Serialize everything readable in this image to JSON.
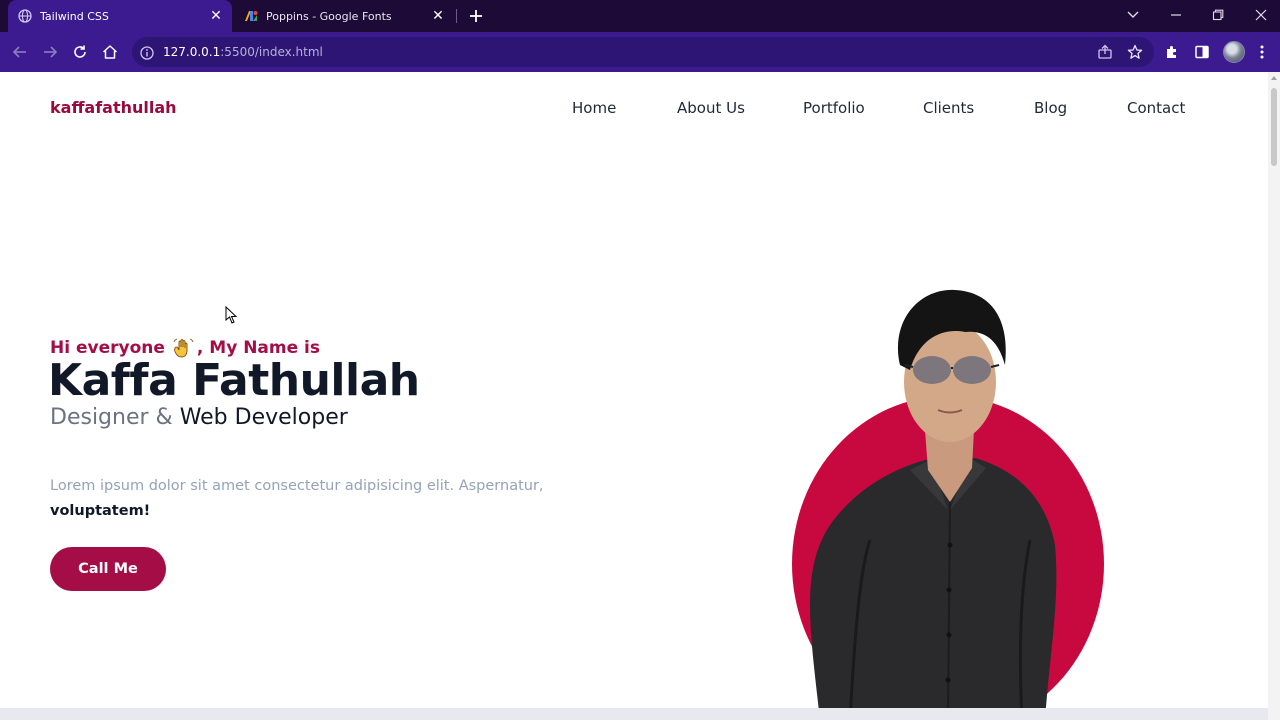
{
  "browser": {
    "tabs": [
      {
        "title": "Tailwind CSS",
        "active": true,
        "favicon": "globe-icon"
      },
      {
        "title": "Poppins - Google Fonts",
        "active": false,
        "favicon": "google-fonts-icon"
      }
    ],
    "url_host": "127.0.0.1",
    "url_rest": ":5500/index.html",
    "accent_color": "#3c1a8f"
  },
  "site": {
    "logo": "kaffafathullah",
    "nav": [
      "Home",
      "About Us",
      "Portfolio",
      "Clients",
      "Blog",
      "Contact"
    ]
  },
  "hero": {
    "greeting_prefix": "Hi everyone",
    "greeting_suffix": ", My Name is",
    "name": "Kaffa Fathullah",
    "role_part1": "Designer & ",
    "role_part2": "Web Developer",
    "description": "Lorem ipsum dolor sit amet consectetur adipisicing elit. Aspernatur,",
    "description_bold": "voluptatem!",
    "cta_label": "Call Me",
    "brand_color": "#a50d47"
  }
}
